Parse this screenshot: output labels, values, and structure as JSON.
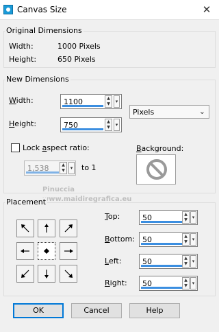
{
  "window": {
    "title": "Canvas Size",
    "close_glyph": "✕"
  },
  "original": {
    "title": "Original Dimensions",
    "width_label": "Width:",
    "width_value": "1000 Pixels",
    "height_label": "Height:",
    "height_value": "650 Pixels"
  },
  "new_dims": {
    "title": "New Dimensions",
    "width_label": "Width:",
    "width_value": "1100",
    "height_label": "Height:",
    "height_value": "750",
    "units_value": "Pixels",
    "lock_label": "Lock aspect ratio:",
    "lock_checked": false,
    "ratio_value": "1,538",
    "ratio_to": "to 1",
    "background_label": "Background:"
  },
  "placement": {
    "title": "Placement",
    "top_label": "Top:",
    "top_value": "50",
    "bottom_label": "Bottom:",
    "bottom_value": "50",
    "left_label": "Left:",
    "left_value": "50",
    "right_label": "Right:",
    "right_value": "50",
    "anchors": [
      "top-left",
      "top",
      "top-right",
      "left",
      "center",
      "right",
      "bottom-left",
      "bottom",
      "bottom-right"
    ],
    "selected_anchor": "center"
  },
  "watermark": {
    "line1": "Pinuccia",
    "line2": "www.maidiregrafica.eu"
  },
  "buttons": {
    "ok": "OK",
    "cancel": "Cancel",
    "help": "Help"
  },
  "colors": {
    "accent": "#3b8ee0",
    "focus": "#0078d7",
    "forbidden": "#9a9a9a"
  },
  "icons": {
    "spin": "spin-arrows-icon",
    "dropdown": "chevron-down-icon",
    "background": "forbidden-icon"
  }
}
